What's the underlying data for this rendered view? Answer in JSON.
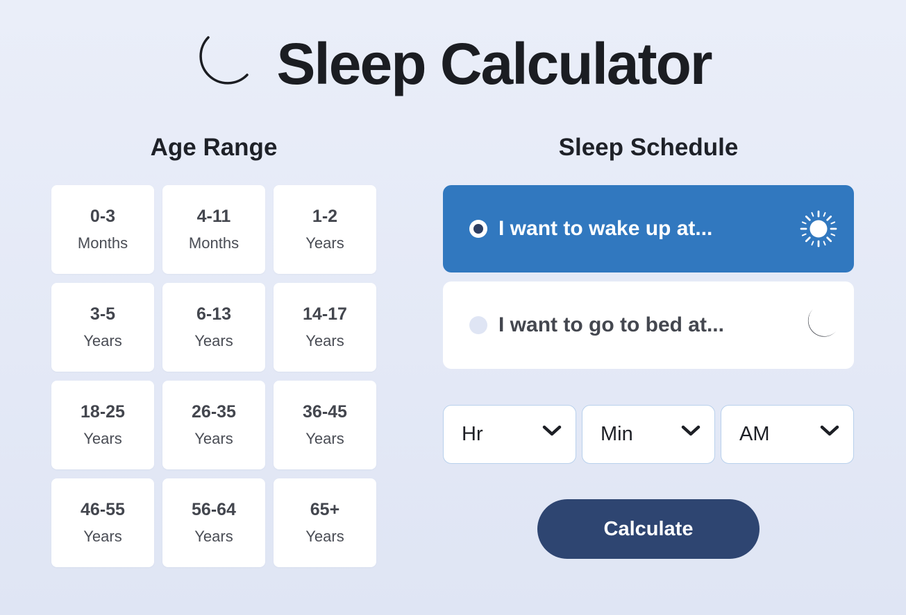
{
  "header": {
    "title": "Sleep Calculator",
    "icon": "moon-outline-icon"
  },
  "age_range": {
    "title": "Age Range",
    "options": [
      {
        "range": "0-3",
        "unit": "Months"
      },
      {
        "range": "4-11",
        "unit": "Months"
      },
      {
        "range": "1-2",
        "unit": "Years"
      },
      {
        "range": "3-5",
        "unit": "Years"
      },
      {
        "range": "6-13",
        "unit": "Years"
      },
      {
        "range": "14-17",
        "unit": "Years"
      },
      {
        "range": "18-25",
        "unit": "Years"
      },
      {
        "range": "26-35",
        "unit": "Years"
      },
      {
        "range": "36-45",
        "unit": "Years"
      },
      {
        "range": "46-55",
        "unit": "Years"
      },
      {
        "range": "56-64",
        "unit": "Years"
      },
      {
        "range": "65+",
        "unit": "Years"
      }
    ]
  },
  "sleep_schedule": {
    "title": "Sleep Schedule",
    "options": [
      {
        "label": "I want to wake up at...",
        "icon": "sun-icon",
        "selected": true
      },
      {
        "label": "I want to go to bed at...",
        "icon": "moon-icon",
        "selected": false
      }
    ],
    "selects": [
      {
        "value": "Hr"
      },
      {
        "value": "Min"
      },
      {
        "value": "AM"
      }
    ],
    "calculate_label": "Calculate"
  },
  "colors": {
    "selected_option_bg": "#3178bf",
    "button_bg": "#2e4571",
    "page_bg": "#e6eaf7"
  }
}
